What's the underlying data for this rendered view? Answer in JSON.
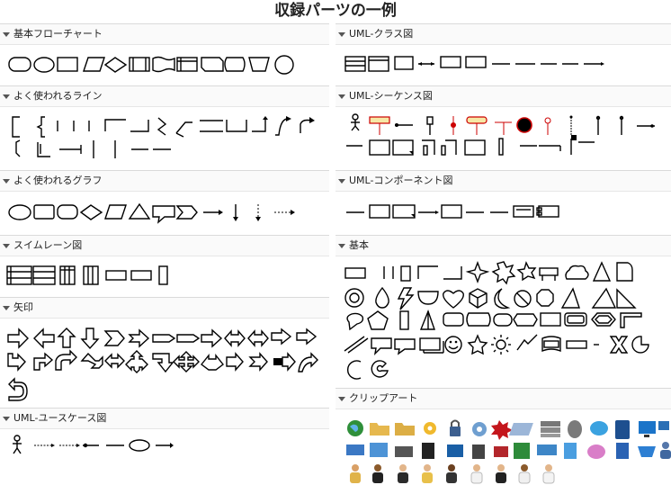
{
  "page_title": "収録パーツの一例",
  "sections": {
    "basic_flowchart": "基本フローチャート",
    "common_lines": "よく使われるライン",
    "common_graphs": "よく使われるグラフ",
    "swimlane": "スイムレーン図",
    "arrows": "矢印",
    "uml_usecase": "UML-ユースケース図",
    "uml_class": "UML-クラス図",
    "uml_sequence": "UML-シーケンス図",
    "uml_component": "UML-コンポーネント図",
    "basic": "基本",
    "clipart": "クリップアート"
  },
  "icons": {
    "collapse": "caret-down-icon"
  },
  "colors": {
    "header_bg": "#fafafa",
    "border": "#dadada",
    "seq_red": "#cc0000",
    "seq_yellow": "#f6e8a6"
  }
}
